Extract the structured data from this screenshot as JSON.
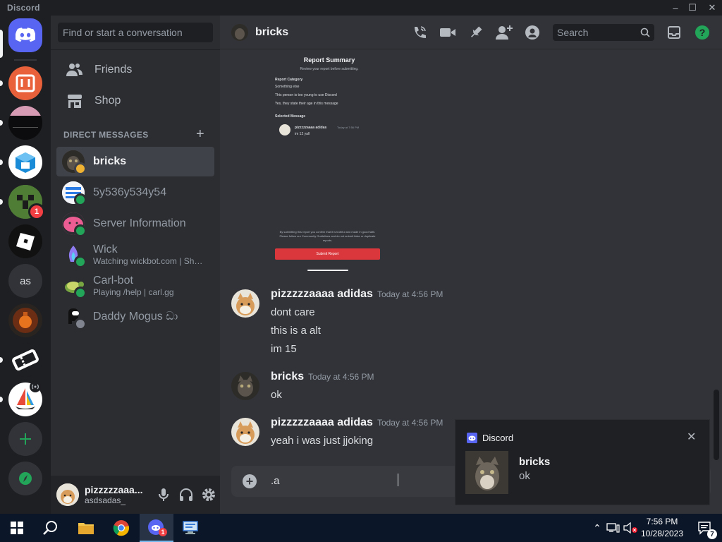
{
  "window": {
    "title": "Discord"
  },
  "sidebar": {
    "search_placeholder": "Find or start a conversation",
    "nav": [
      {
        "label": "Friends",
        "icon": "friends-icon"
      },
      {
        "label": "Shop",
        "icon": "shop-icon"
      }
    ],
    "dm_header": "DIRECT MESSAGES",
    "dms": [
      {
        "name": "bricks",
        "status": "",
        "presence": "idle"
      },
      {
        "name": "5y536y534y54",
        "status": "",
        "presence": "online"
      },
      {
        "name": "Server Information",
        "status": "",
        "presence": "online"
      },
      {
        "name": "Wick",
        "status": "Watching wickbot.com | Shar...",
        "presence": "online"
      },
      {
        "name": "Carl-bot",
        "status": "Playing /help | carl.gg",
        "presence": "online"
      },
      {
        "name": "Daddy Mogus ඩා",
        "status": "",
        "presence": "offline"
      }
    ]
  },
  "servers": {
    "home_icon": "discord-logo-icon",
    "items": [
      {
        "label": "",
        "badge": ""
      },
      {
        "label": "",
        "badge": ""
      },
      {
        "label": "",
        "badge": ""
      },
      {
        "label": "",
        "badge": "1"
      },
      {
        "label": "",
        "badge": ""
      },
      {
        "label": "as",
        "badge": ""
      },
      {
        "label": "",
        "badge": ""
      },
      {
        "label": "",
        "badge": ""
      },
      {
        "label": "",
        "badge": ""
      }
    ]
  },
  "user": {
    "name": "pizzzzzaaa...",
    "tag": "asdsadas_"
  },
  "channel": {
    "title": "bricks",
    "search_placeholder": "Search"
  },
  "report": {
    "title": "Report Summary",
    "subtitle": "Review your report before submitting.",
    "category_label": "Report Category",
    "items": [
      "Something else",
      "This person is too young to use Discord",
      "Yes, they state their age in this message"
    ],
    "selected_label": "Selected Message",
    "selected_author": "pizzzzzaaaa adidas",
    "selected_time": "Today at 7:56 PM",
    "selected_text": "im 12 yall",
    "footer": "By submitting this report you confirm that it is truthful and made in good faith. Please follow our Community Guidelines and do not submit false or duplicate reports.",
    "submit_label": "Submit Report"
  },
  "messages": [
    {
      "author": "pizzzzzaaaa adidas",
      "time": "Today at 4:56 PM",
      "lines": [
        "dont care",
        "this is a alt",
        "im 15"
      ]
    },
    {
      "author": "bricks",
      "time": "Today at 4:56 PM",
      "lines": [
        "ok"
      ]
    },
    {
      "author": "pizzzzzaaaa adidas",
      "time": "Today at 4:56 PM",
      "lines": [
        "yeah i was just jjoking"
      ]
    }
  ],
  "composer": {
    "value": ".a"
  },
  "toast": {
    "app": "Discord",
    "title": "bricks",
    "body": "ok"
  },
  "taskbar": {
    "time": "7:56 PM",
    "date": "10/28/2023",
    "notif_count": "7",
    "discord_badge": "1"
  },
  "colors": {
    "accent": "#5865f2",
    "online": "#23a559",
    "idle": "#f0b232",
    "danger": "#f23f43",
    "green": "#23a559"
  }
}
